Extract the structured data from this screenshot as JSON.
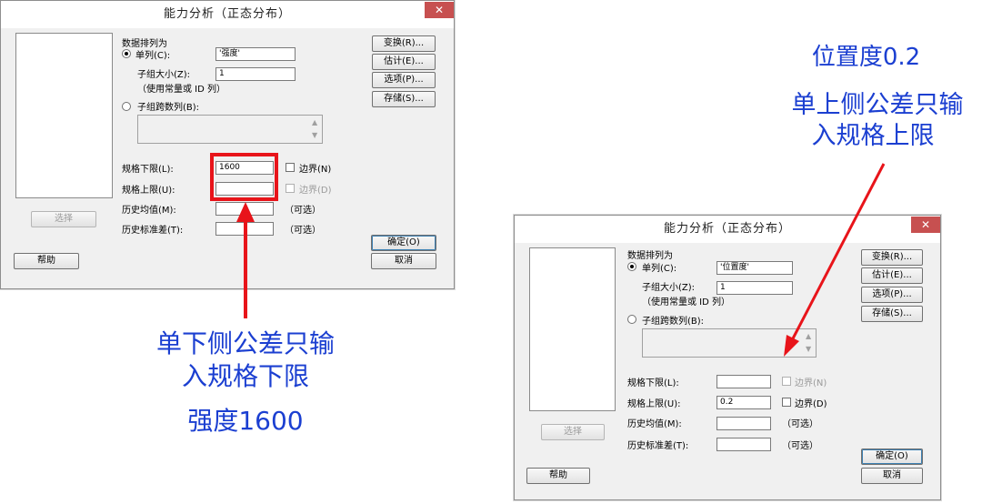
{
  "left_dialog": {
    "title": "能力分析（正态分布）",
    "close": "✕",
    "data_arrangement": "数据排列为",
    "single_column": "单列(C):",
    "single_column_value": "'强度'",
    "subgroup_size": "子组大小(Z):",
    "subgroup_size_value": "1",
    "subgroup_hint": "（使用常量或 ID 列）",
    "subgroups_across": "子组跨数列(B):",
    "lsl": "规格下限(L):",
    "lsl_value": "1600",
    "usl": "规格上限(U):",
    "usl_value": "",
    "boundary_lower": "边界(N)",
    "boundary_upper": "边界(D)",
    "hist_mean": "历史均值(M):",
    "hist_sd": "历史标准差(T):",
    "optional_1": "（可选）",
    "optional_2": "（可选）",
    "btn_transform": "变换(R)...",
    "btn_estimate": "估计(E)...",
    "btn_options": "选项(P)...",
    "btn_storage": "存储(S)...",
    "btn_select": "选择",
    "btn_help": "帮助",
    "btn_ok": "确定(O)",
    "btn_cancel": "取消"
  },
  "right_dialog": {
    "title": "能力分析（正态分布）",
    "close": "✕",
    "data_arrangement": "数据排列为",
    "single_column": "单列(C):",
    "single_column_value": "'位置度'",
    "subgroup_size": "子组大小(Z):",
    "subgroup_size_value": "1",
    "subgroup_hint": "（使用常量或 ID 列）",
    "subgroups_across": "子组跨数列(B):",
    "lsl": "规格下限(L):",
    "lsl_value": "",
    "usl": "规格上限(U):",
    "usl_value": "0.2",
    "boundary_lower": "边界(N)",
    "boundary_upper": "边界(D)",
    "hist_mean": "历史均值(M):",
    "hist_sd": "历史标准差(T):",
    "optional_1": "（可选）",
    "optional_2": "（可选）",
    "btn_transform": "变换(R)...",
    "btn_estimate": "估计(E)...",
    "btn_options": "选项(P)...",
    "btn_storage": "存储(S)...",
    "btn_select": "选择",
    "btn_help": "帮助",
    "btn_ok": "确定(O)",
    "btn_cancel": "取消"
  },
  "annotations": {
    "left_line1": "单下侧公差只输",
    "left_line2": "入规格下限",
    "left_value": "强度1600",
    "right_value": "位置度0.2",
    "right_line1": "单上侧公差只输",
    "right_line2": "入规格上限"
  },
  "colors": {
    "annotation_blue": "#1b3fd1",
    "highlight_red": "#e8141a",
    "close_red": "#c75050"
  }
}
